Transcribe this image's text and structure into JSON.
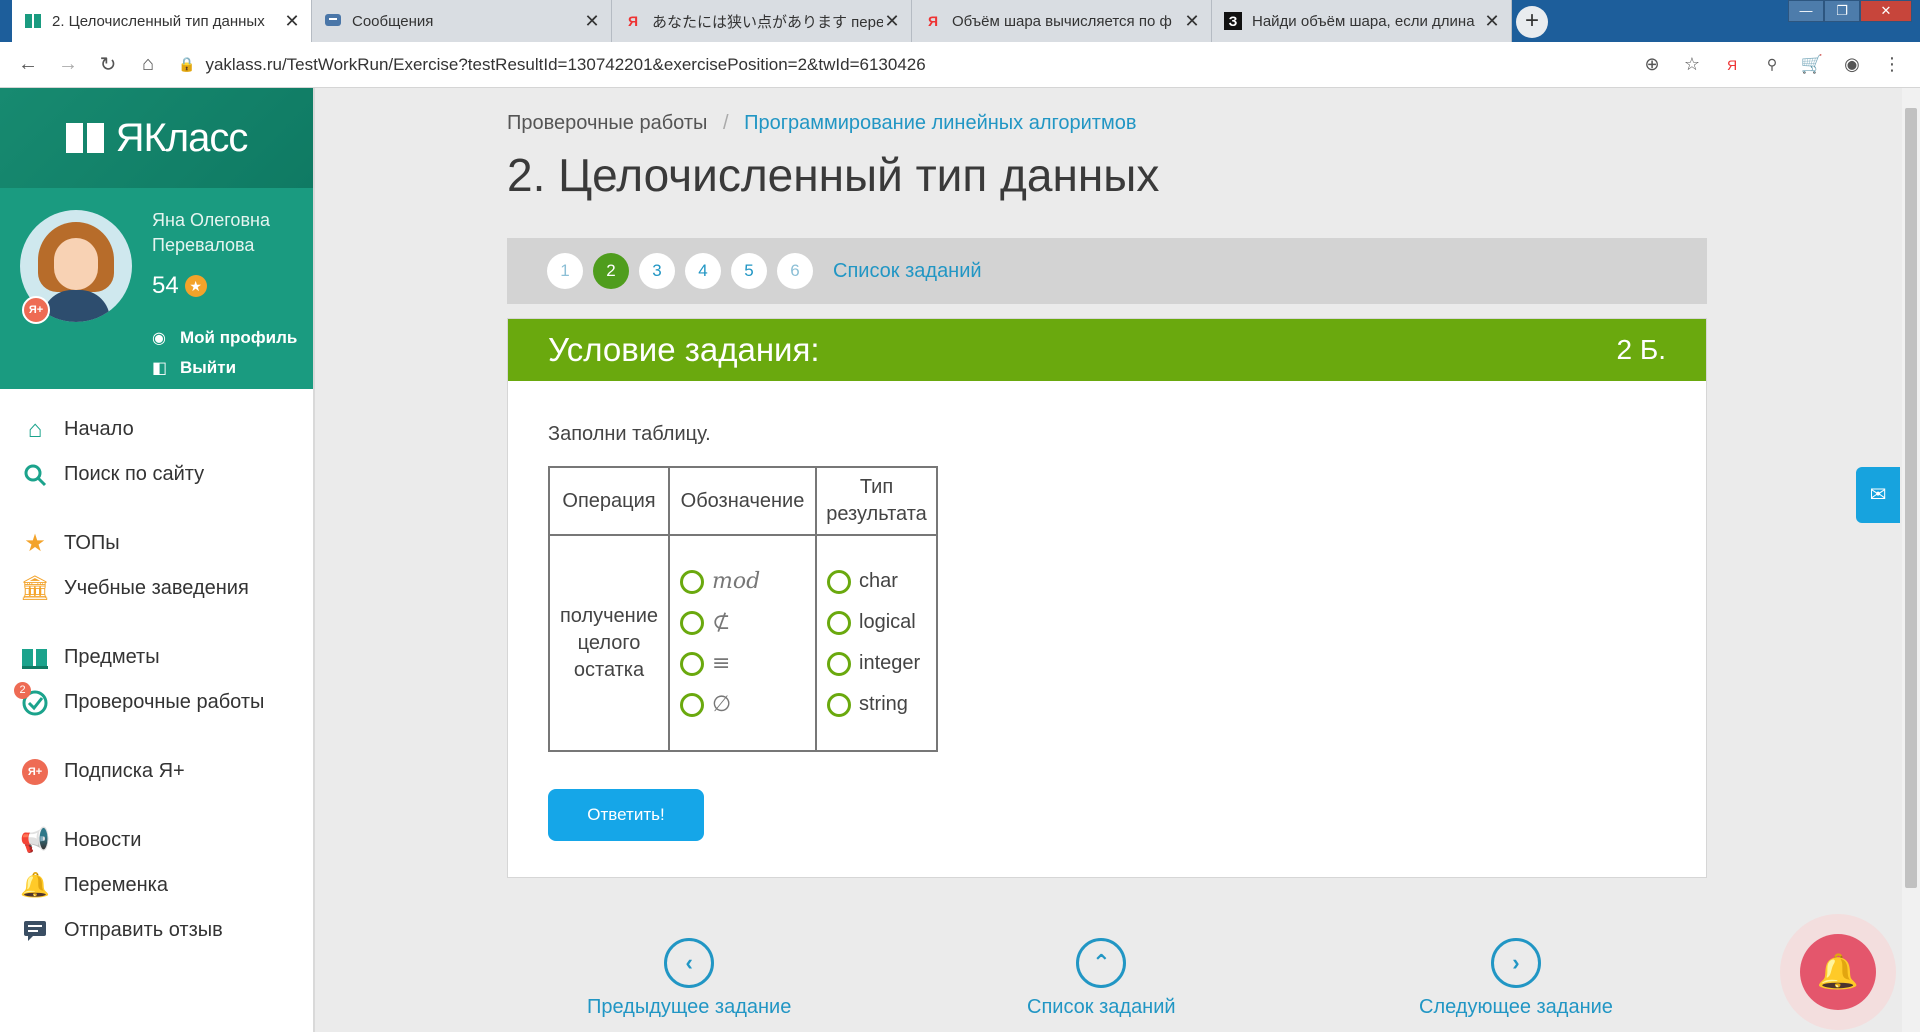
{
  "browser": {
    "tabs": [
      {
        "title": "2. Целочисленный тип данных",
        "icon": "yaklass-book-icon",
        "active": true
      },
      {
        "title": "Сообщения",
        "icon": "messages-icon",
        "active": false
      },
      {
        "title": "あなたには狭い点があります перево",
        "icon": "yandex-icon",
        "active": false
      },
      {
        "title": "Объём шара вычисляется по ф",
        "icon": "yandex-icon",
        "active": false
      },
      {
        "title": "Найди объём шара, если длина",
        "icon": "znanija-icon",
        "active": false
      }
    ],
    "new_tab_label": "+",
    "url": "yaklass.ru/TestWorkRun/Exercise?testResultId=130742201&exercisePosition=2&twId=6130426",
    "icons": {
      "yandex_glyph": "Я",
      "znanija_glyph": "З",
      "close_glyph": "✕"
    }
  },
  "sidebar": {
    "logo_text": "ЯКласс",
    "user": {
      "first_line": "Яна Олеговна",
      "second_line": "Перевалова",
      "score": "54",
      "ya_plus_badge": "Я+",
      "star_glyph": "★"
    },
    "profile_links": [
      {
        "label": "Мой профиль",
        "icon": "user-circle-icon"
      },
      {
        "label": "Выйти",
        "icon": "logout-icon"
      }
    ],
    "menu_groups": [
      [
        {
          "label": "Начало",
          "icon": "home-icon",
          "color": "#1ba38c"
        },
        {
          "label": "Поиск по сайту",
          "icon": "search-icon",
          "color": "#1ba38c"
        }
      ],
      [
        {
          "label": "ТОПы",
          "icon": "star-icon",
          "color": "#f3a32a"
        },
        {
          "label": "Учебные заведения",
          "icon": "school-icon",
          "color": "#f3a32a"
        }
      ],
      [
        {
          "label": "Предметы",
          "icon": "books-icon",
          "color": "#1ba38c"
        },
        {
          "label": "Проверочные работы",
          "icon": "check-icon",
          "color": "#1ba38c",
          "badge": "2"
        }
      ],
      [
        {
          "label": "Подписка Я+",
          "icon": "ya-plus-icon",
          "color": "#ee6b54"
        }
      ],
      [
        {
          "label": "Новости",
          "icon": "megaphone-icon",
          "color": "#3a4e63"
        },
        {
          "label": "Переменка",
          "icon": "bell-icon",
          "color": "#3a4e63"
        },
        {
          "label": "Отправить отзыв",
          "icon": "feedback-icon",
          "color": "#3a4e63"
        }
      ]
    ]
  },
  "breadcrumb": {
    "root": "Проверочные работы",
    "separator": "/",
    "current": "Программирование линейных алгоритмов"
  },
  "page_title": "2. Целочисленный тип данных",
  "pager": {
    "pages": [
      "1",
      "2",
      "3",
      "4",
      "5",
      "6"
    ],
    "current_page": "2",
    "list_label": "Список заданий"
  },
  "task": {
    "header_title": "Условие задания:",
    "points": "2 Б.",
    "instruction": "Заполни таблицу.",
    "table": {
      "headers": [
        "Операция",
        "Обозначение",
        "Тип результата"
      ],
      "operation": "получение целого остатка",
      "symbol_options": [
        "mod",
        "⊄",
        "≡",
        "∅"
      ],
      "type_options": [
        "char",
        "logical",
        "integer",
        "string"
      ]
    },
    "answer_button": "Ответить!"
  },
  "bottom_nav": {
    "prev": "Предыдущее задание",
    "list": "Список заданий",
    "next": "Следующее задание"
  },
  "colors": {
    "brand_green": "#1a9b80",
    "task_header": "#6aa90e",
    "link_blue": "#2196c4",
    "button_blue": "#15a6e8",
    "notification_red": "#e4566c"
  }
}
